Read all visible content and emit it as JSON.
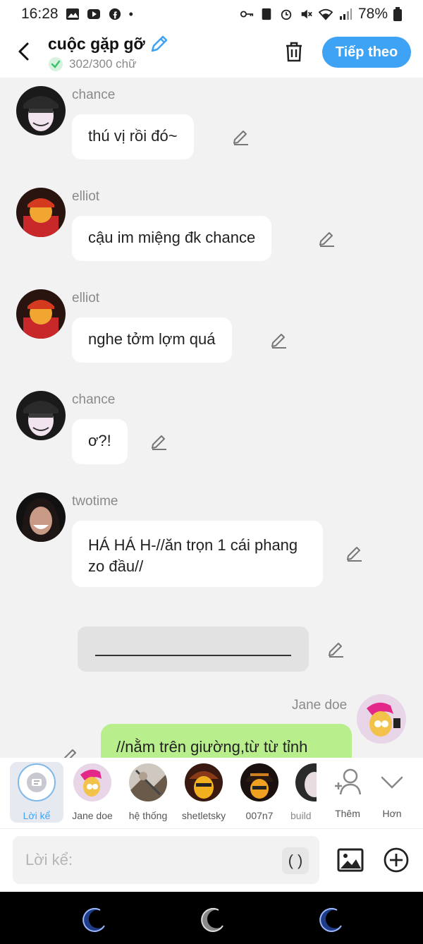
{
  "status_bar": {
    "time": "16:28",
    "battery": "78%"
  },
  "header": {
    "title": "cuộc gặp gỡ",
    "word_count": "302/300 chữ",
    "next_label": "Tiếp theo"
  },
  "messages": [
    {
      "sender": "chance",
      "text": "thú vị rồi đó~"
    },
    {
      "sender": "elliot",
      "text": "cậu im miệng đk chance"
    },
    {
      "sender": "elliot",
      "text": "nghe tởm lợm quá"
    },
    {
      "sender": "chance",
      "text": "ơ?!"
    },
    {
      "sender": "twotime",
      "text": "HÁ HÁ H-//ăn trọn 1 cái phang zo đầu//"
    }
  ],
  "my_message": {
    "sender": "Jane doe",
    "text": "//nằm trên giường,từ từ tỉnh"
  },
  "characters": [
    {
      "label": "Lời kể"
    },
    {
      "label": "Jane doe"
    },
    {
      "label": "hệ thống"
    },
    {
      "label": "shetletsky"
    },
    {
      "label": "007n7"
    },
    {
      "label": "build"
    },
    {
      "label": "Thêm"
    },
    {
      "label": "Hơn"
    }
  ],
  "input": {
    "placeholder": "Lời kể:",
    "paren": "( )"
  },
  "colors": {
    "accent": "#3fa3f5",
    "my_bubble": "#b8ef8c",
    "check": "#3cc46d"
  },
  "icons": [
    "back-arrow-icon",
    "pencil-icon",
    "check-icon",
    "trash-icon",
    "edit-icon",
    "add-person-icon",
    "chevron-down-icon",
    "image-icon",
    "plus-circle-icon",
    "moon-icon"
  ]
}
